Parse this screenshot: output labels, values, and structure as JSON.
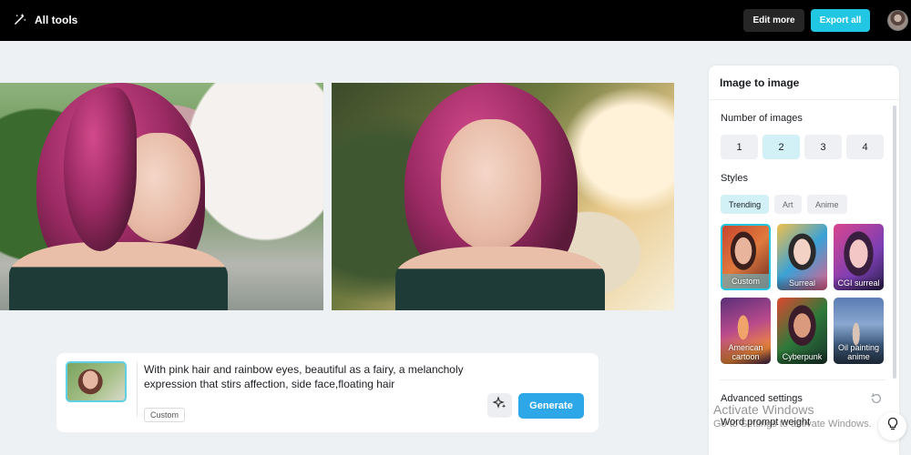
{
  "header": {
    "all_tools_label": "All tools",
    "edit_more_label": "Edit more",
    "export_all_label": "Export all",
    "colors": {
      "bar": "#000000",
      "accent": "#21c6e2"
    }
  },
  "prompt": {
    "text": "With pink hair and rainbow eyes, beautiful as a fairy, a melancholy expression that stirs affection, side face,floating hair",
    "style_tag": "Custom",
    "generate_label": "Generate"
  },
  "panel": {
    "title": "Image to image",
    "number_label": "Number of images",
    "numbers": [
      "1",
      "2",
      "3",
      "4"
    ],
    "selected_number": "2",
    "styles_label": "Styles",
    "style_tabs": [
      "Trending",
      "Art",
      "Anime"
    ],
    "selected_tab": "Trending",
    "styles": [
      {
        "label": "Custom",
        "selected": true
      },
      {
        "label": "Surreal",
        "selected": false
      },
      {
        "label": "CGI surreal",
        "selected": false
      },
      {
        "label": "American cartoon",
        "selected": false
      },
      {
        "label": "Cyberpunk",
        "selected": false
      },
      {
        "label": "Oil painting anime",
        "selected": false
      }
    ],
    "advanced_label": "Advanced settings",
    "word_prompt_weight_label": "Word prompt weight"
  },
  "watermark": {
    "line1": "Activate Windows",
    "line2": "Go to Settings to activate Windows."
  }
}
